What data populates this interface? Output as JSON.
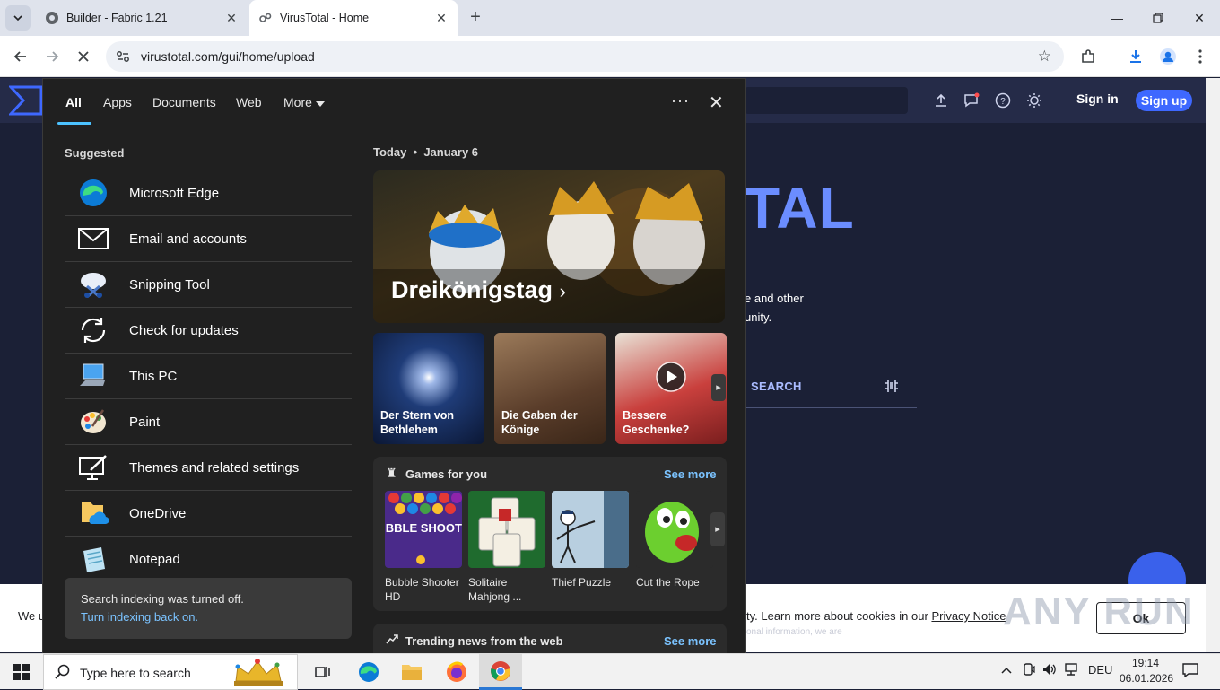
{
  "browser": {
    "tabs": [
      {
        "title": "Builder - Fabric 1.21",
        "active": false
      },
      {
        "title": "VirusTotal - Home",
        "active": true
      }
    ],
    "url": "virustotal.com/gui/home/upload"
  },
  "vt": {
    "signin": "Sign in",
    "signup": "Sign up",
    "title_fragment": "TAL",
    "desc_line1": "e and other",
    "desc_line2": "unity.",
    "search_tab": "SEARCH",
    "cookie_left": "We u",
    "cookie_right_prefix": "ty. Learn more about cookies in our ",
    "cookie_privacy_link": "Privacy Notice",
    "cookie_faint": "onal information, we are",
    "cookie_ok": "Ok",
    "watermark": "ANY RUN"
  },
  "flyout": {
    "tabs": [
      "All",
      "Apps",
      "Documents",
      "Web",
      "More"
    ],
    "suggested_heading": "Suggested",
    "suggested": [
      {
        "label": "Microsoft Edge",
        "icon": "edge-icon"
      },
      {
        "label": "Email and accounts",
        "icon": "mail-icon"
      },
      {
        "label": "Snipping Tool",
        "icon": "snipping-tool-icon"
      },
      {
        "label": "Check for updates",
        "icon": "sync-icon"
      },
      {
        "label": "This PC",
        "icon": "computer-icon"
      },
      {
        "label": "Paint",
        "icon": "paint-palette-icon"
      },
      {
        "label": "Themes and related settings",
        "icon": "themes-icon"
      },
      {
        "label": "OneDrive",
        "icon": "onedrive-icon"
      },
      {
        "label": "Notepad",
        "icon": "notepad-icon"
      }
    ],
    "index_message": "Search indexing was turned off.",
    "index_link": "Turn indexing back on.",
    "today_label": "Today",
    "today_date": "January 6",
    "hero_title": "Dreikönigstag",
    "cards": [
      {
        "label": "Der Stern von Bethlehem"
      },
      {
        "label": "Die Gaben der Könige"
      },
      {
        "label": "Bessere Geschenke?"
      }
    ],
    "games_title": "Games for you",
    "games_more": "See more",
    "games": [
      {
        "label": "Bubble Shooter HD",
        "tile_text": "BUBBLE SHOOTER"
      },
      {
        "label": "Solitaire Mahjong ..."
      },
      {
        "label": "Thief Puzzle"
      },
      {
        "label": "Cut the Rope"
      }
    ],
    "trending_title": "Trending news from the web",
    "trending_more": "See more"
  },
  "taskbar": {
    "search_placeholder": "Type here to search",
    "tray_lang": "DEU",
    "time": "19:14",
    "date": "06.01.2026"
  },
  "colors": {
    "vt_accent": "#3e68ff",
    "flyout_bg": "#202020",
    "link_blue": "#7bc3ff"
  }
}
